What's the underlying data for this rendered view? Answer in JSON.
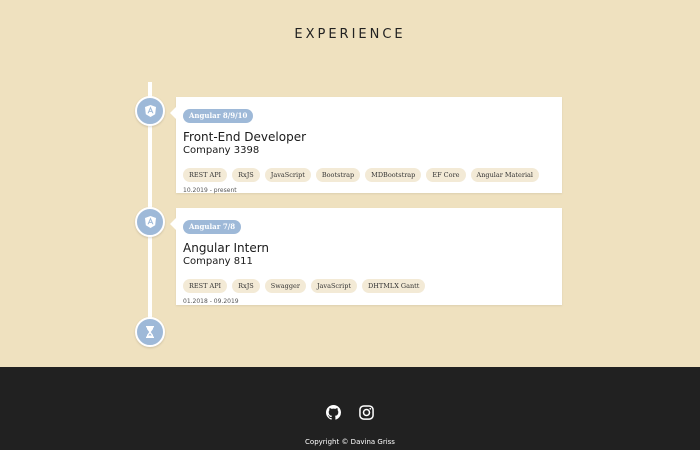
{
  "section": {
    "title": "EXPERIENCE"
  },
  "experiences": [
    {
      "badge": "Angular 8/9/10",
      "title": "Front-End Developer",
      "company": "Company 3398",
      "tags": [
        "REST API",
        "RxJS",
        "JavaScript",
        "Bootstrap",
        "MDBootstrap",
        "EF Core",
        "Angular Material"
      ],
      "period": "10.2019 - present",
      "icon": "angular-icon"
    },
    {
      "badge": "Angular 7/8",
      "title": "Angular Intern",
      "company": "Company 811",
      "tags": [
        "REST API",
        "RxJS",
        "Swagger",
        "JavaScript",
        "DHTMLX Gantt"
      ],
      "period": "01.2018 - 09.2019",
      "icon": "angular-icon"
    }
  ],
  "timeline_end": {
    "icon": "hourglass-icon"
  },
  "footer": {
    "social": [
      {
        "name": "github-icon"
      },
      {
        "name": "instagram-icon"
      }
    ],
    "copyright": "Copyright © Davina Griss"
  },
  "colors": {
    "background": "#efe1bf",
    "accent": "#9eb9d8",
    "footer": "#212121",
    "tag_background": "#f3ead6"
  }
}
